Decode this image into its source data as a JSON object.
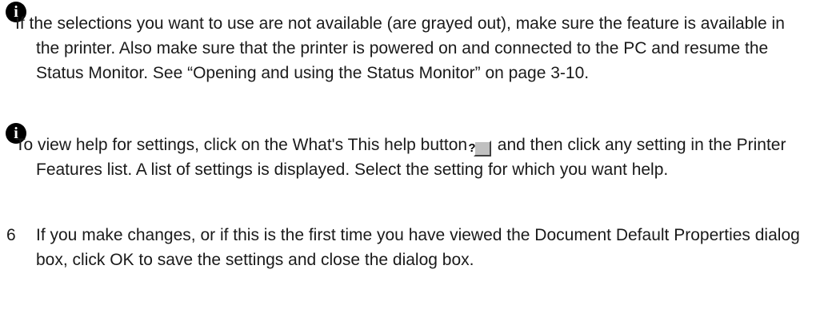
{
  "notes": [
    {
      "icon": "info-icon",
      "text": "If the selections you want to use are not available (are grayed out), make sure the feature is available in the printer. Also make sure that the printer is powered on and connected to the PC and resume the Status Monitor. See “Opening and using the Status Monitor” on page 3-10."
    },
    {
      "icon": "info-icon",
      "text_before": "To view help for settings, click on the What's This help button",
      "button_glyph": "?",
      "text_after": "and then click any setting in the Printer Features list. A list of settings is displayed. Select the setting for which you want help."
    }
  ],
  "step": {
    "number": "6",
    "text": "If you make changes, or if this is the first time you have viewed the Document Default Properties dialog box, click OK to save the settings and close the dialog box."
  }
}
